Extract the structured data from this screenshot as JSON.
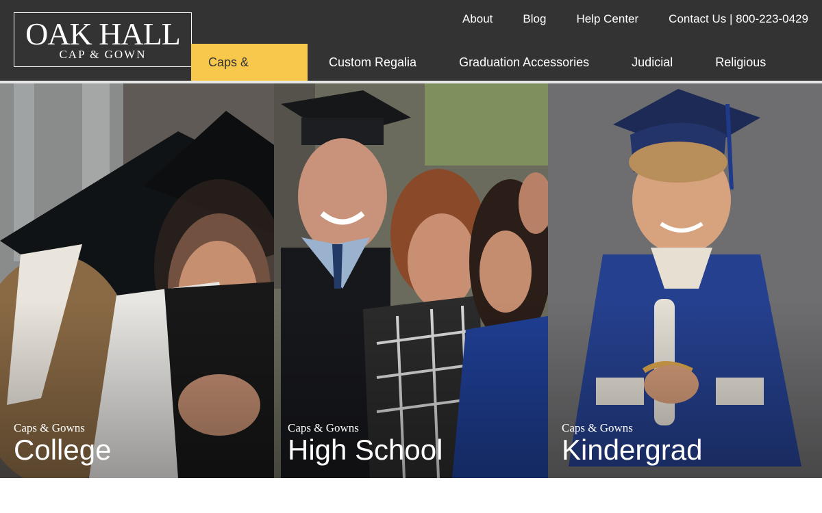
{
  "brand": {
    "name": "OAK HALL",
    "tagline": "CAP & GOWN"
  },
  "utility_nav": [
    {
      "label": "About"
    },
    {
      "label": "Blog"
    },
    {
      "label": "Help Center"
    },
    {
      "label": "Contact Us | 800-223-0429"
    }
  ],
  "main_nav": [
    {
      "label": "Caps & Gowns",
      "active": true
    },
    {
      "label": "Custom Regalia"
    },
    {
      "label": "Graduation Accessories"
    },
    {
      "label": "Judicial"
    },
    {
      "label": "Religious"
    }
  ],
  "tiles": [
    {
      "kicker": "Caps & Gowns",
      "title": "College"
    },
    {
      "kicker": "Caps & Gowns",
      "title": "High School"
    },
    {
      "kicker": "Caps & Gowns",
      "title": "Kindergrad"
    }
  ],
  "colors": {
    "header": "#333333",
    "active_nav": "#f7c84b"
  }
}
